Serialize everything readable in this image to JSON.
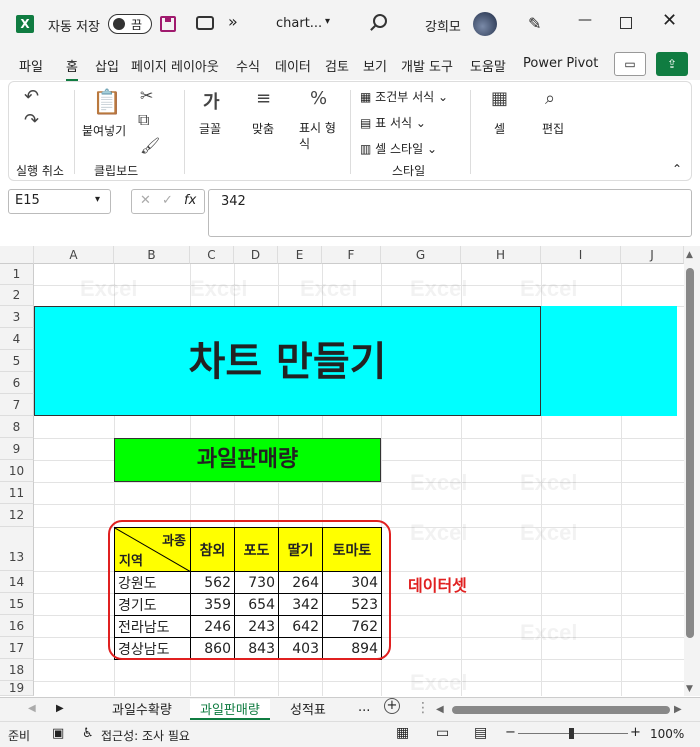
{
  "titlebar": {
    "autosave_label": "자동 저장",
    "autosave_state": "끔",
    "filename": "chart...",
    "user": "강희모",
    "more": "»"
  },
  "menu": [
    "파일",
    "홈",
    "삽입",
    "페이지 레이아웃",
    "수식",
    "데이터",
    "검토",
    "보기",
    "개발 도구",
    "도움말",
    "Power Pivot"
  ],
  "ribbon": {
    "undo_group": "실행 취소",
    "paste": "붙여넣기",
    "clipboard_group": "클립보드",
    "font": "글꼴",
    "align": "맞춤",
    "number": "표시 형\n식",
    "cond_format": "조건부 서식",
    "table_format": "표 서식",
    "cell_style": "셀 스타일",
    "style_group": "스타일",
    "cells": "셀",
    "edit": "편집"
  },
  "formula_bar": {
    "namebox": "E15",
    "formula": "342"
  },
  "columns": [
    "A",
    "B",
    "C",
    "D",
    "E",
    "F",
    "G",
    "H",
    "I",
    "J"
  ],
  "rows": [
    "1",
    "2",
    "3",
    "4",
    "5",
    "6",
    "7",
    "8",
    "9",
    "10",
    "11",
    "12",
    "13",
    "14",
    "15",
    "16",
    "17",
    "18",
    "19"
  ],
  "sheet": {
    "title": "차트 만들기",
    "subtitle": "과일판매량",
    "corner_top": "과종",
    "corner_bottom": "지역",
    "headers": [
      "참외",
      "포도",
      "딸기",
      "토마토"
    ],
    "data": [
      {
        "region": "강원도",
        "values": [
          "562",
          "730",
          "264",
          "304"
        ]
      },
      {
        "region": "경기도",
        "values": [
          "359",
          "654",
          "342",
          "523"
        ]
      },
      {
        "region": "전라남도",
        "values": [
          "246",
          "243",
          "642",
          "762"
        ]
      },
      {
        "region": "경상남도",
        "values": [
          "860",
          "843",
          "403",
          "894"
        ]
      }
    ],
    "annotation": "데이터셋"
  },
  "sheet_tabs": [
    "과일수확량",
    "과일판매량",
    "성적표"
  ],
  "sheet_tabs_more": "...",
  "status": {
    "ready": "준비",
    "accessibility": "접근성: 조사 필요",
    "zoom": "100%"
  },
  "watermark": "Excel"
}
